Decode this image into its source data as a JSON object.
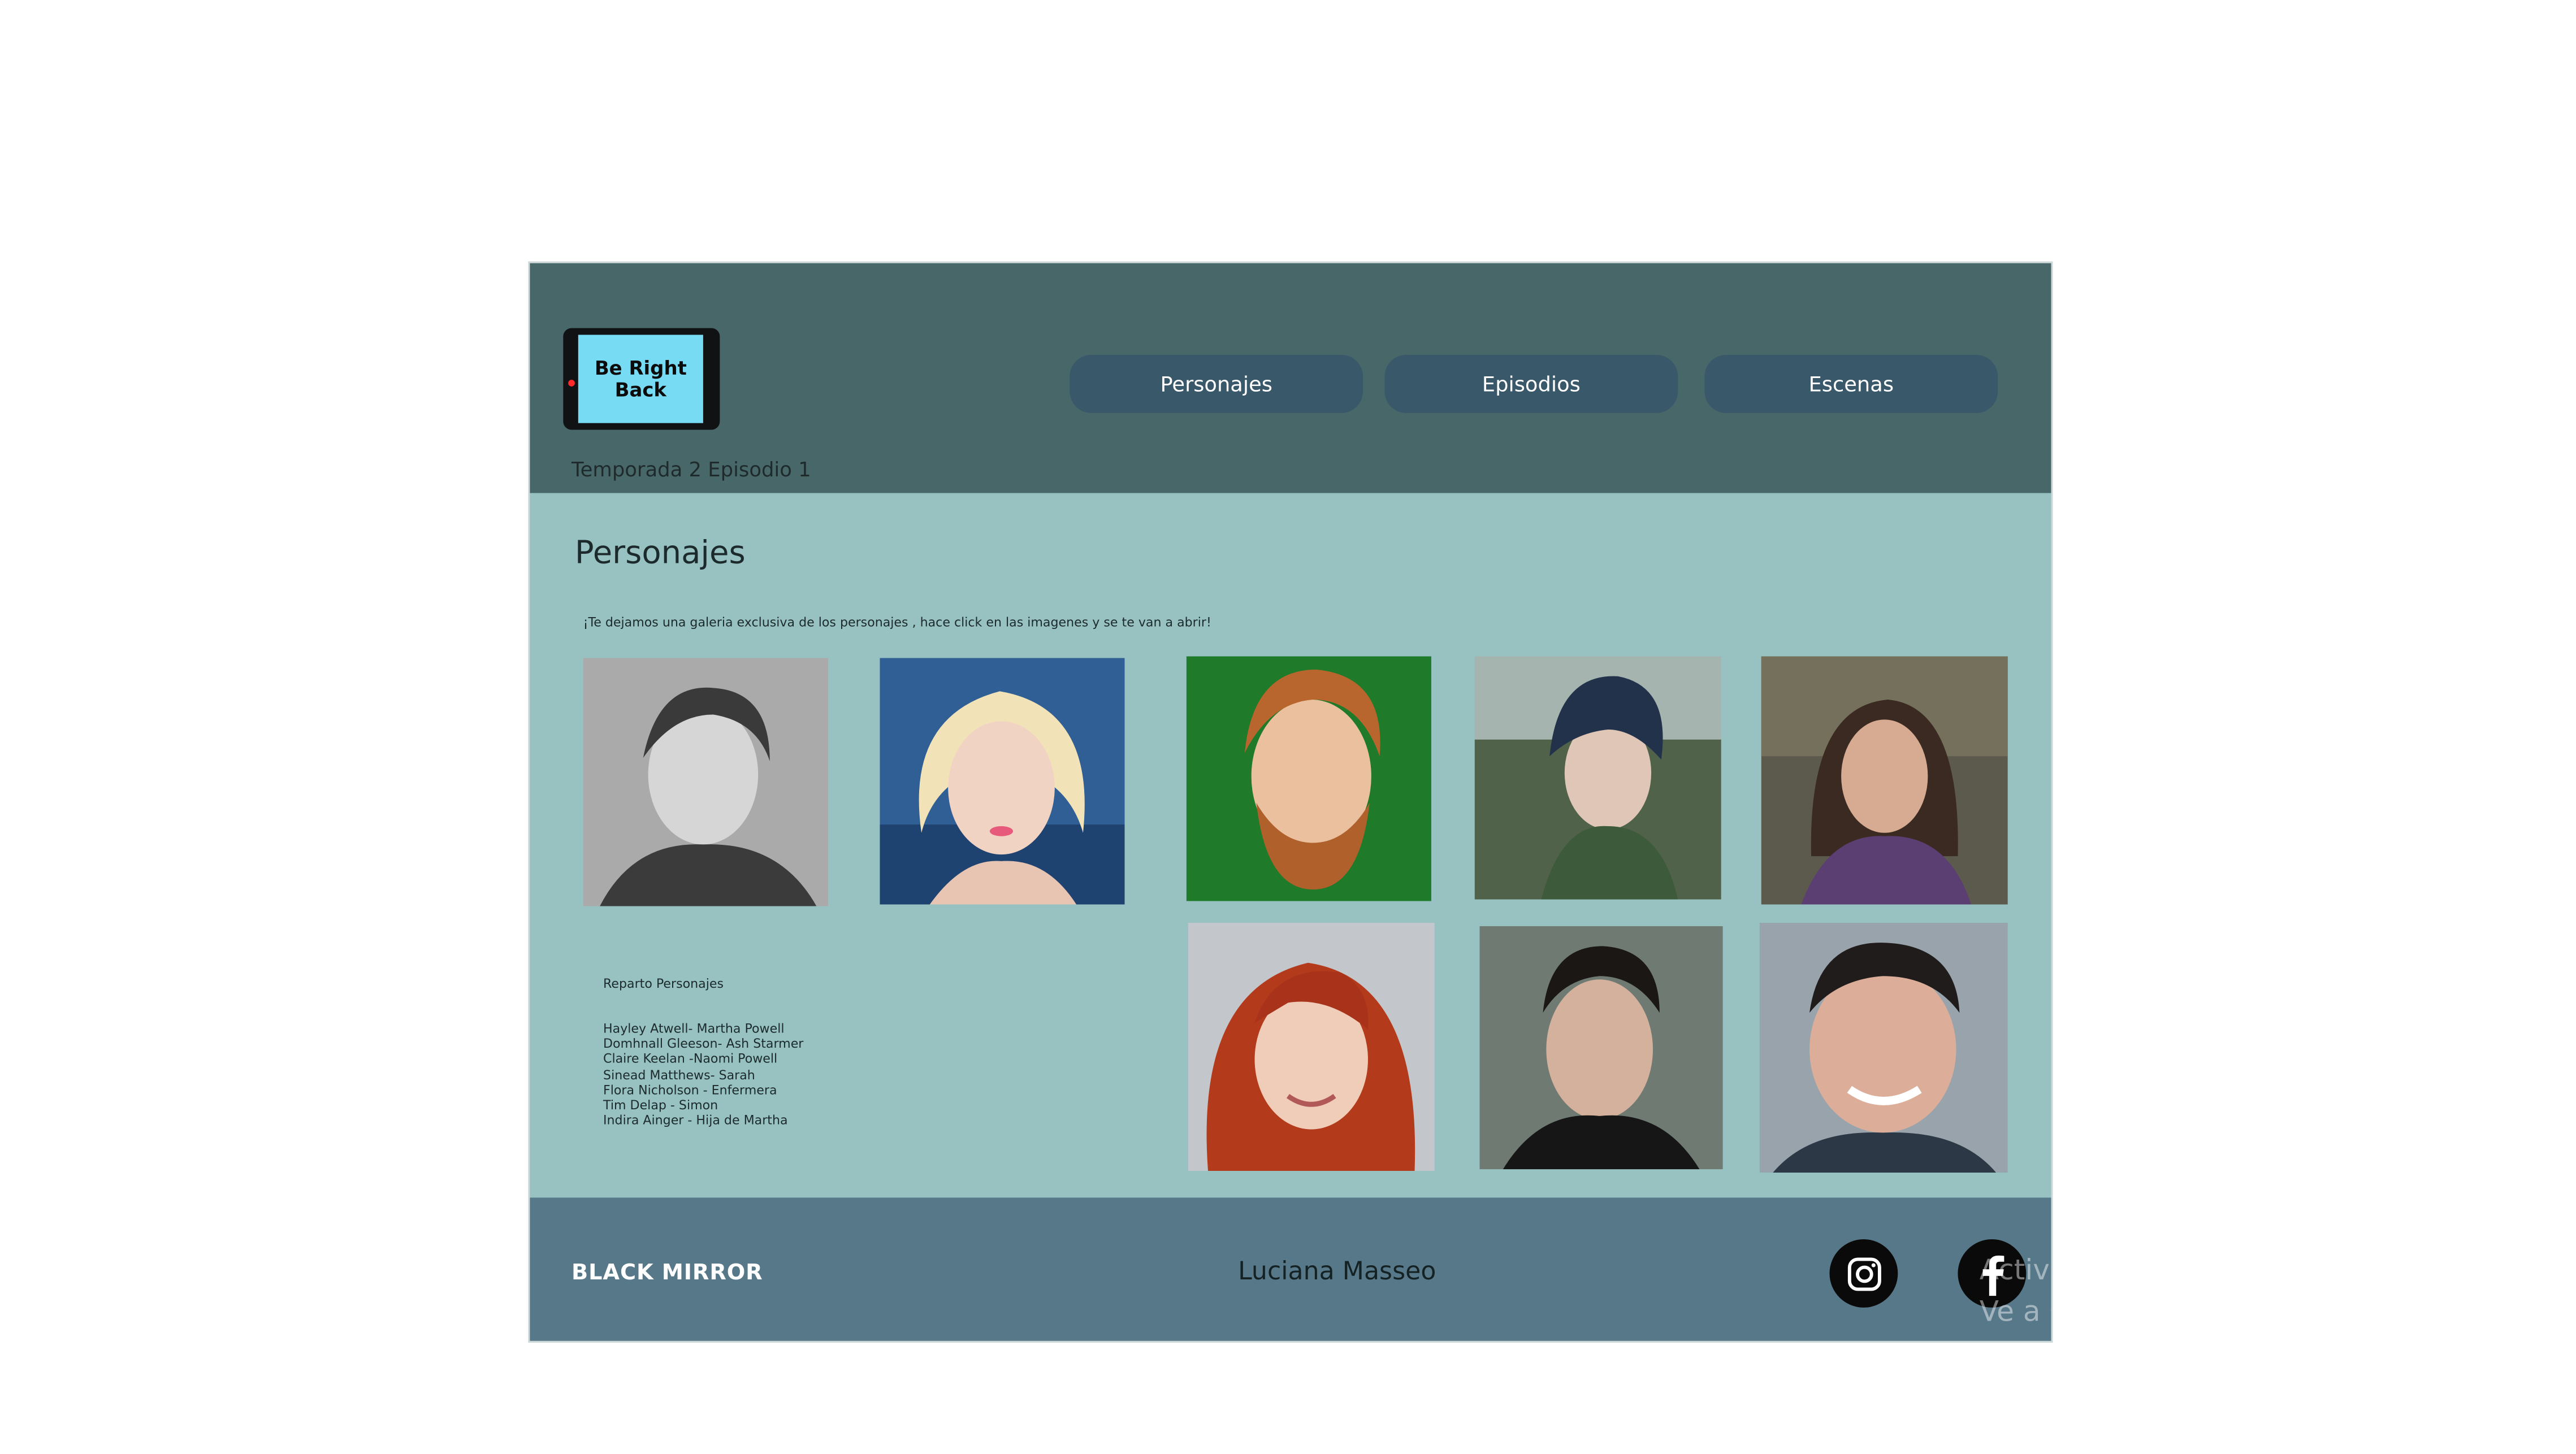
{
  "header": {
    "logo_text": "Be Right\nBack",
    "subtitle": "Temporada 2 Episodio 1",
    "nav": [
      {
        "label": "Personajes"
      },
      {
        "label": "Episodios"
      },
      {
        "label": "Escenas"
      }
    ]
  },
  "main": {
    "title": "Personajes",
    "intro": "¡Te dejamos una galeria exclusiva de los personajes , hace click en las imagenes y se te van a abrir!",
    "cast_title": "Reparto Personajes",
    "cast": [
      "Hayley Atwell- Martha Powell",
      "Domhnall Gleeson- Ash Starmer",
      "Claire Keelan -Naomi Powell",
      "Sinead Matthews- Sarah",
      "Flora Nicholson - Enfermera",
      "Tim Delap - Simon",
      "Indira Ainger - Hija de Martha"
    ]
  },
  "footer": {
    "brand": "BLACK MIRROR",
    "author": "Luciana Masseo",
    "social": [
      {
        "icon": "instagram-icon"
      },
      {
        "icon": "facebook-icon"
      }
    ],
    "watermark": "Activ\nVe a C"
  },
  "colors": {
    "header_bg": "#486769",
    "body_bg": "#97c2c1",
    "footer_bg": "#577889",
    "nav_button": "#39596b",
    "logo_screen": "#78dbf4"
  }
}
